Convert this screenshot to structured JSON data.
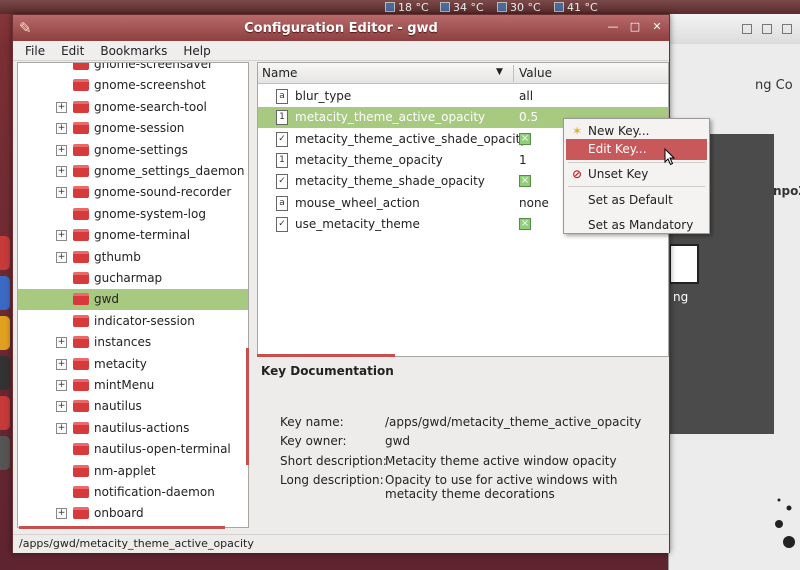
{
  "panel": {
    "temps": [
      "18 °C",
      "34 °C",
      "30 °C",
      "41 °C"
    ]
  },
  "background_window": {
    "fragment_top": "ng Co",
    "fragment_mid": "npoZe",
    "fragment_low": "ng"
  },
  "window": {
    "title": "Configuration Editor - gwd",
    "menu": [
      {
        "label": "File"
      },
      {
        "label": "Edit"
      },
      {
        "label": "Bookmarks"
      },
      {
        "label": "Help"
      }
    ]
  },
  "tree": {
    "items": [
      {
        "label": "gnome-screensaver",
        "expandable": false,
        "selected": false
      },
      {
        "label": "gnome-screenshot",
        "expandable": false,
        "selected": false
      },
      {
        "label": "gnome-search-tool",
        "expandable": true,
        "selected": false
      },
      {
        "label": "gnome-session",
        "expandable": true,
        "selected": false
      },
      {
        "label": "gnome-settings",
        "expandable": true,
        "selected": false
      },
      {
        "label": "gnome_settings_daemon",
        "expandable": true,
        "selected": false
      },
      {
        "label": "gnome-sound-recorder",
        "expandable": true,
        "selected": false
      },
      {
        "label": "gnome-system-log",
        "expandable": false,
        "selected": false
      },
      {
        "label": "gnome-terminal",
        "expandable": true,
        "selected": false
      },
      {
        "label": "gthumb",
        "expandable": true,
        "selected": false
      },
      {
        "label": "gucharmap",
        "expandable": false,
        "selected": false
      },
      {
        "label": "gwd",
        "expandable": false,
        "selected": true
      },
      {
        "label": "indicator-session",
        "expandable": false,
        "selected": false
      },
      {
        "label": "instances",
        "expandable": true,
        "selected": false
      },
      {
        "label": "metacity",
        "expandable": true,
        "selected": false
      },
      {
        "label": "mintMenu",
        "expandable": true,
        "selected": false
      },
      {
        "label": "nautilus",
        "expandable": true,
        "selected": false
      },
      {
        "label": "nautilus-actions",
        "expandable": true,
        "selected": false
      },
      {
        "label": "nautilus-open-terminal",
        "expandable": false,
        "selected": false
      },
      {
        "label": "nm-applet",
        "expandable": false,
        "selected": false
      },
      {
        "label": "notification-daemon",
        "expandable": false,
        "selected": false
      },
      {
        "label": "onboard",
        "expandable": true,
        "selected": false
      }
    ]
  },
  "keys": {
    "col_name": "Name",
    "col_value": "Value",
    "rows": [
      {
        "name": "blur_type",
        "kind": "string",
        "value": "all",
        "selected": false
      },
      {
        "name": "metacity_theme_active_opacity",
        "kind": "number",
        "value": "0.5",
        "selected": true
      },
      {
        "name": "metacity_theme_active_shade_opacity",
        "kind": "bool",
        "value": "",
        "selected": false
      },
      {
        "name": "metacity_theme_opacity",
        "kind": "number",
        "value": "1",
        "selected": false
      },
      {
        "name": "metacity_theme_shade_opacity",
        "kind": "bool",
        "value": "",
        "selected": false
      },
      {
        "name": "mouse_wheel_action",
        "kind": "string",
        "value": "none",
        "selected": false
      },
      {
        "name": "use_metacity_theme",
        "kind": "bool",
        "value": "",
        "selected": false
      }
    ]
  },
  "doc": {
    "title": "Key Documentation",
    "key_name_label": "Key name:",
    "key_name": "/apps/gwd/metacity_theme_active_opacity",
    "key_owner_label": "Key owner:",
    "key_owner": "gwd",
    "short_desc_label": "Short description:",
    "short_desc": "Metacity theme active window opacity",
    "long_desc_label": "Long description:",
    "long_desc": "Opacity to use for active windows with metacity theme decorations"
  },
  "status": {
    "path": "/apps/gwd/metacity_theme_active_opacity"
  },
  "context_menu": {
    "items": [
      {
        "label": "New Key...",
        "icon": "new-key-icon",
        "highlighted": false
      },
      {
        "label": "Edit Key...",
        "icon": "",
        "highlighted": true
      },
      {
        "label": "Unset Key",
        "icon": "unset-icon",
        "highlighted": false
      },
      {
        "label": "Set as Default",
        "icon": "",
        "highlighted": false
      },
      {
        "label": "Set as Mandatory",
        "icon": "",
        "highlighted": false
      }
    ]
  }
}
